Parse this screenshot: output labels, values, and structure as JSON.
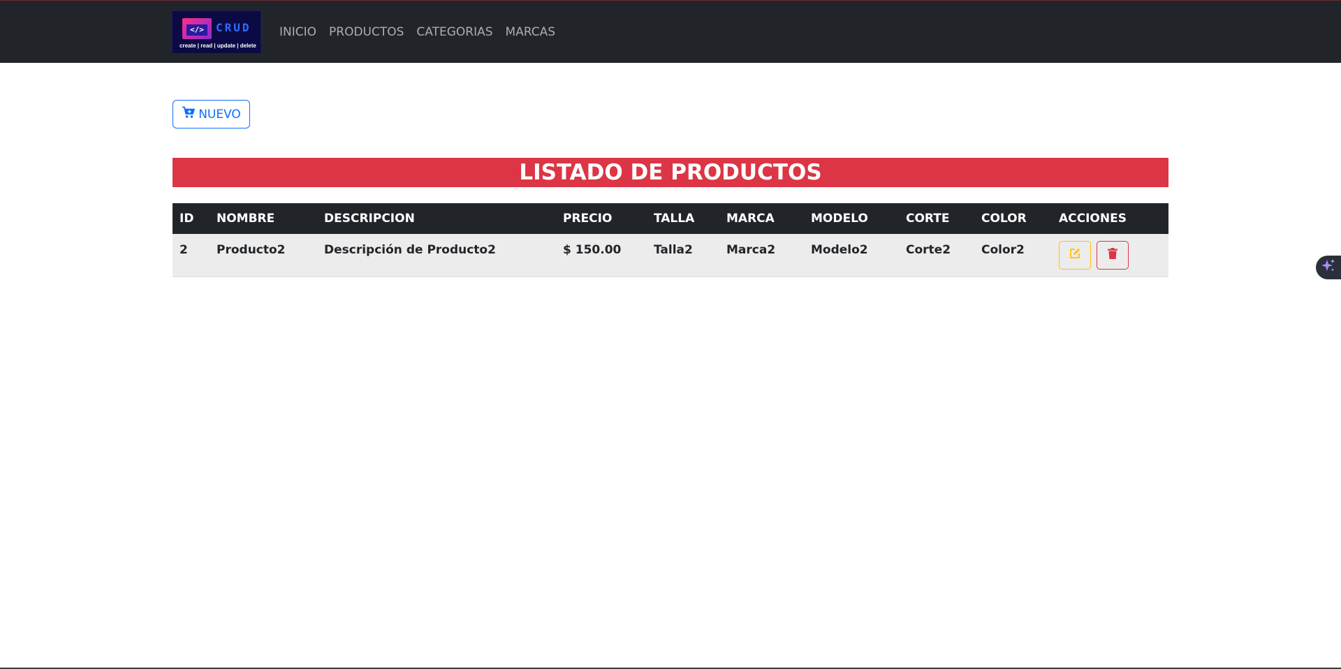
{
  "brand": {
    "code": "</>",
    "title": "CRUD",
    "subtitle": "create | read | update | delete"
  },
  "nav": {
    "items": [
      {
        "label": "INICIO"
      },
      {
        "label": "PRODUCTOS"
      },
      {
        "label": "CATEGORIAS"
      },
      {
        "label": "MARCAS"
      }
    ]
  },
  "toolbar": {
    "new_label": "NUEVO",
    "new_icon": "cart-plus-icon"
  },
  "page": {
    "title": "LISTADO DE PRODUCTOS"
  },
  "table": {
    "headers": [
      "ID",
      "NOMBRE",
      "DESCRIPCION",
      "PRECIO",
      "TALLA",
      "MARCA",
      "MODELO",
      "CORTE",
      "COLOR",
      "ACCIONES"
    ],
    "rows": [
      {
        "id": "2",
        "nombre": "Producto2",
        "descripcion": "Descripción de Producto2",
        "precio": "$ 150.00",
        "talla": "Talla2",
        "marca": "Marca2",
        "modelo": "Modelo2",
        "corte": "Corte2",
        "color": "Color2",
        "actions": [
          "edit-icon",
          "trash-icon"
        ]
      }
    ]
  },
  "colors": {
    "navbar": "#212529",
    "primary": "#0d6efd",
    "danger": "#dc3545",
    "warning": "#ffc107",
    "row_bg": "#ececec"
  }
}
